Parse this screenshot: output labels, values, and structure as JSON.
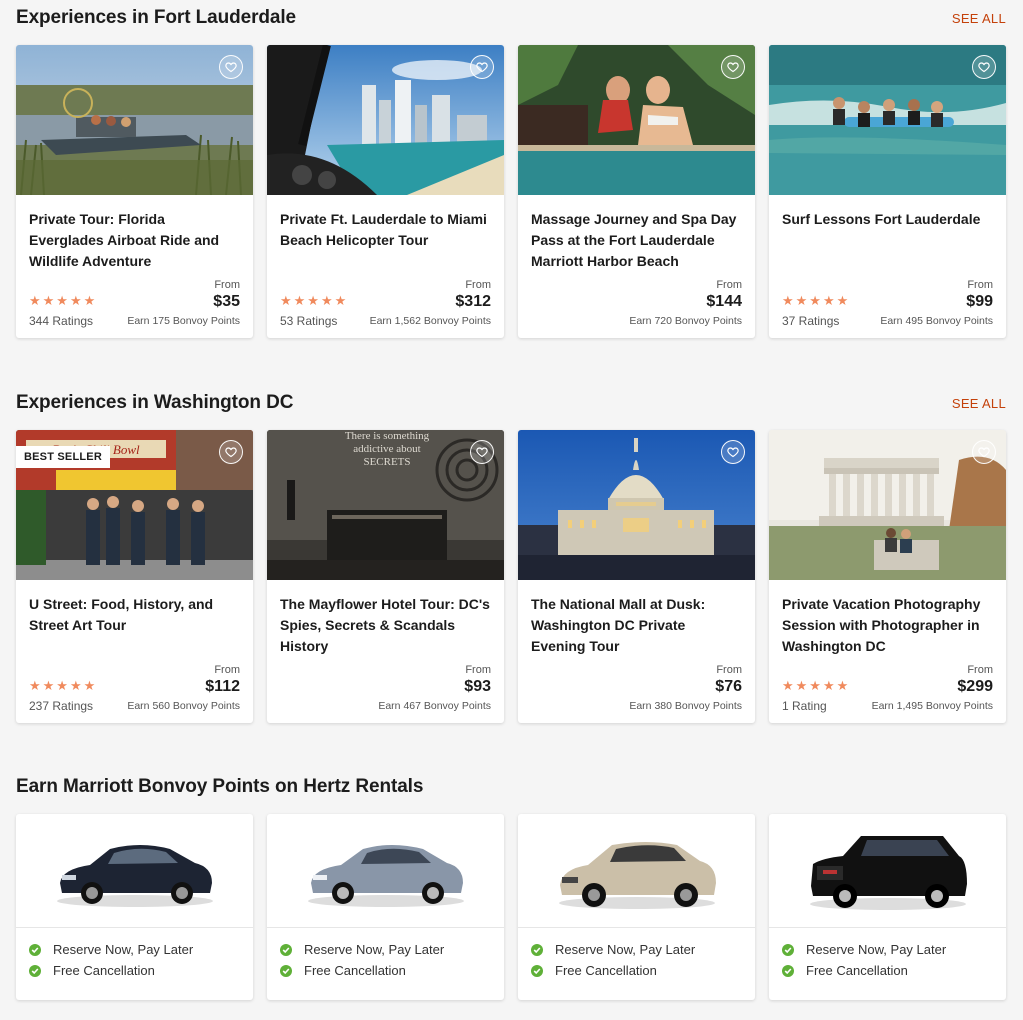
{
  "sections": [
    {
      "title": "Experiences in Fort Lauderdale",
      "see_all": "SEE ALL",
      "cards": [
        {
          "title": "Private Tour: Florida Everglades Airboat Ride and Wildlife Adventure",
          "stars": "★★★★★",
          "ratings": "344 Ratings",
          "from": "From",
          "price": "$35",
          "points": "Earn 175 Bonvoy Points"
        },
        {
          "title": "Private Ft. Lauderdale to Miami Beach Helicopter Tour",
          "stars": "★★★★★",
          "ratings": "53 Ratings",
          "from": "From",
          "price": "$312",
          "points": "Earn 1,562 Bonvoy Points"
        },
        {
          "title": "Massage Journey and Spa Day Pass at the Fort Lauderdale Marriott Harbor Beach",
          "stars": "",
          "ratings": "",
          "from": "From",
          "price": "$144",
          "points": "Earn 720 Bonvoy Points"
        },
        {
          "title": "Surf Lessons Fort Lauderdale",
          "stars": "★★★★★",
          "ratings": "37 Ratings",
          "from": "From",
          "price": "$99",
          "points": "Earn 495 Bonvoy Points"
        }
      ]
    },
    {
      "title": "Experiences in Washington DC",
      "see_all": "SEE ALL",
      "cards": [
        {
          "badge": "BEST SELLER",
          "title": "U Street: Food, History, and Street Art Tour",
          "stars": "★★★★★",
          "ratings": "237 Ratings",
          "from": "From",
          "price": "$112",
          "points": "Earn 560 Bonvoy Points"
        },
        {
          "title": "The Mayflower Hotel Tour: DC's Spies, Secrets & Scandals History",
          "stars": "",
          "ratings": "",
          "from": "From",
          "price": "$93",
          "points": "Earn 467 Bonvoy Points"
        },
        {
          "title": "The National Mall at Dusk: Washington DC Private Evening Tour",
          "stars": "",
          "ratings": "",
          "from": "From",
          "price": "$76",
          "points": "Earn 380 Bonvoy Points"
        },
        {
          "title": "Private Vacation Photography Session with Photographer in Washington DC",
          "stars": "★★★★★",
          "ratings": "1 Rating",
          "from": "From",
          "price": "$299",
          "points": "Earn 1,495 Bonvoy Points"
        }
      ]
    }
  ],
  "photo_signs": {
    "bens_chili_bowl": "Ben's Chili Bowl",
    "mural": "There is something addictive about SECRETS"
  },
  "hertz": {
    "title": "Earn Marriott Bonvoy Points on Hertz Rentals",
    "cars": [
      {
        "icon": "dark-sedan-car-image",
        "color": "#1d2433",
        "feature1": "Reserve Now, Pay Later",
        "feature2": "Free Cancellation"
      },
      {
        "icon": "silver-sedan-car-image",
        "color": "#8996a8",
        "feature1": "Reserve Now, Pay Later",
        "feature2": "Free Cancellation"
      },
      {
        "icon": "beige-suv-car-image",
        "color": "#cbbfa8",
        "feature1": "Reserve Now, Pay Later",
        "feature2": "Free Cancellation"
      },
      {
        "icon": "black-suv-car-image",
        "color": "#111111",
        "feature1": "Reserve Now, Pay Later",
        "feature2": "Free Cancellation"
      }
    ]
  },
  "colors": {
    "accent": "#c4410a",
    "stars": "#f08a5d",
    "check": "#5fb038"
  }
}
